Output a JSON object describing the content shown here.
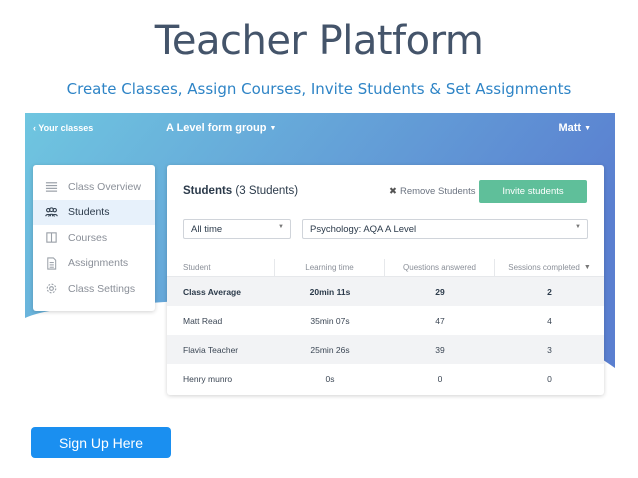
{
  "header": {
    "title": "Teacher Platform",
    "subtitle": "Create Classes, Assign Courses, Invite Students & Set Assignments"
  },
  "app": {
    "back_link": "Your classes",
    "group_name": "A Level form group",
    "user_name": "Matt",
    "colors": {
      "top_gradient_start": "#6fc6e0",
      "top_gradient_end": "#5a7fd0",
      "accent_green": "#5fbf9a"
    }
  },
  "sidebar": {
    "items": [
      {
        "label": "Class Overview",
        "icon": "list-icon"
      },
      {
        "label": "Students",
        "icon": "people-icon"
      },
      {
        "label": "Courses",
        "icon": "book-icon"
      },
      {
        "label": "Assignments",
        "icon": "document-icon"
      },
      {
        "label": "Class Settings",
        "icon": "gear-icon"
      }
    ]
  },
  "students_panel": {
    "heading": "Students",
    "count_text": "(3 Students)",
    "remove_label": "Remove Students",
    "invite_label": "Invite students",
    "time_filter": "All time",
    "course_filter": "Psychology: AQA A Level",
    "columns": [
      "Student",
      "Learning time",
      "Questions answered",
      "Sessions completed"
    ],
    "rows": [
      {
        "name": "Class Average",
        "time": "20min 11s",
        "questions": "29",
        "sessions": "2"
      },
      {
        "name": "Matt Read",
        "time": "35min 07s",
        "questions": "47",
        "sessions": "4"
      },
      {
        "name": "Flavia Teacher",
        "time": "25min 26s",
        "questions": "39",
        "sessions": "3"
      },
      {
        "name": "Henry munro",
        "time": "0s",
        "questions": "0",
        "sessions": "0"
      }
    ]
  },
  "cta": {
    "signup_label": "Sign Up Here"
  }
}
